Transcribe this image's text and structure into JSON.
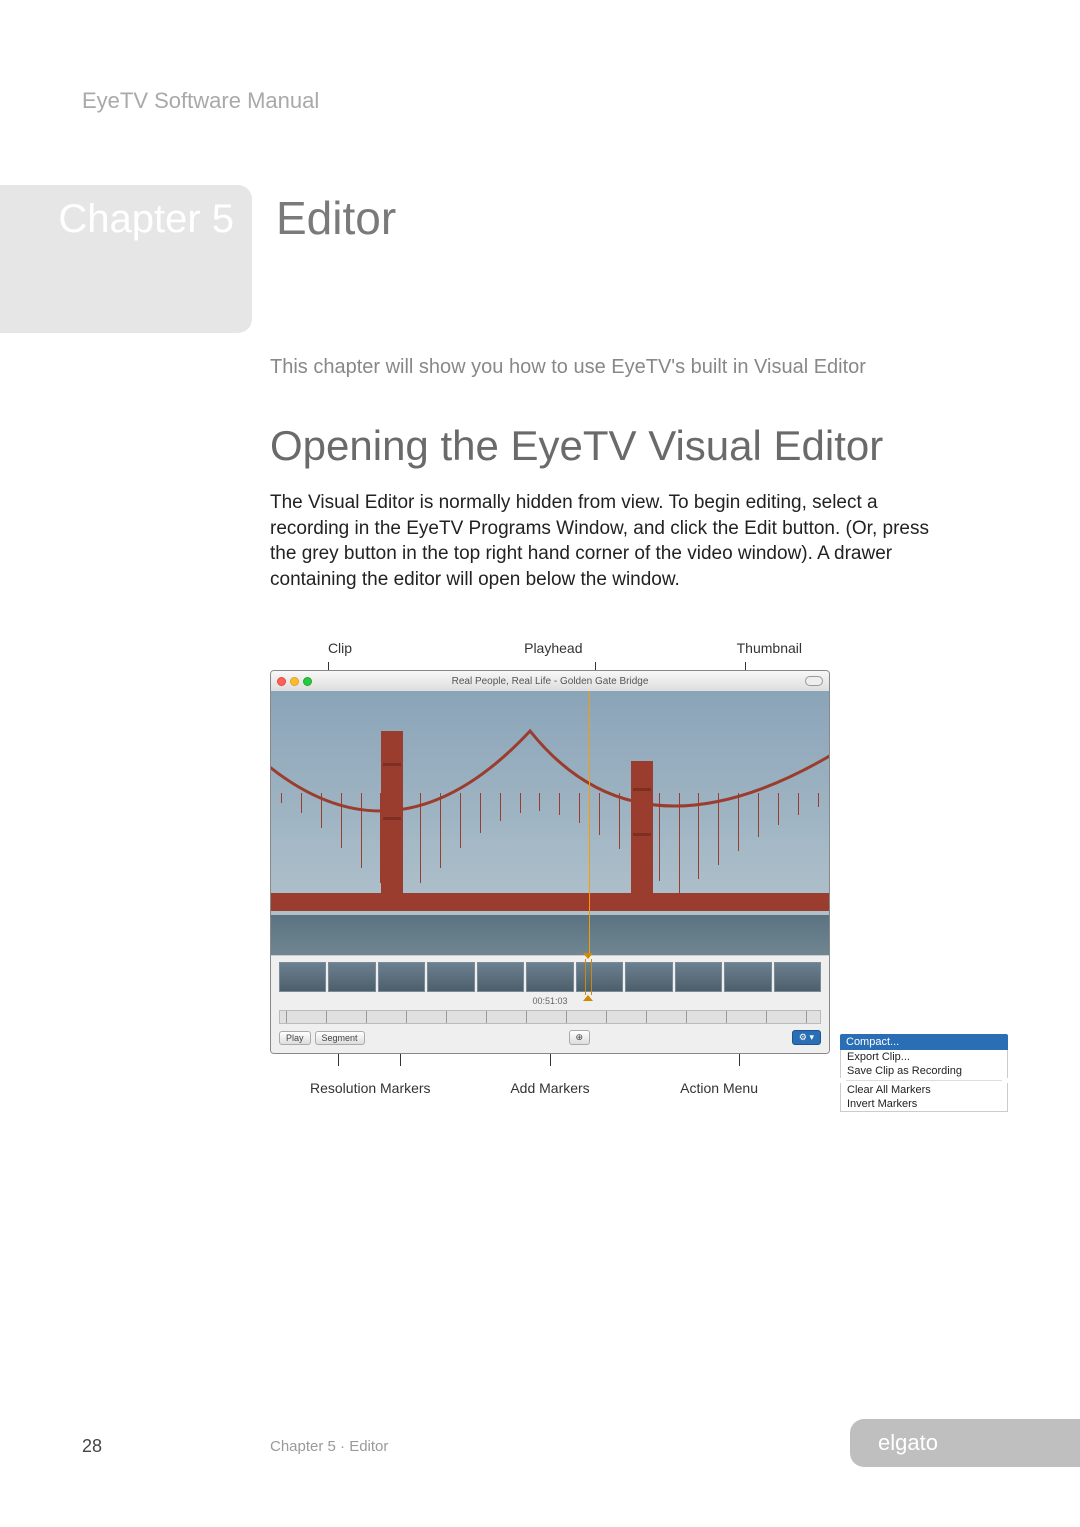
{
  "header": "EyeTV Software Manual",
  "chapter_label": "Chapter 5",
  "chapter_title": "Editor",
  "intro": "This chapter will show you how to use EyeTV's built in Visual Editor",
  "section_heading": "Opening the EyeTV Visual Editor",
  "body": "The Visual Editor is normally hidden from view. To begin editing, select a recording in the EyeTV Programs Window, and click the Edit button. (Or, press the grey button in the top right hand corner of the video window). A drawer containing the editor will open below the window.",
  "figure": {
    "callouts_top": {
      "clip": "Clip",
      "playhead": "Playhead",
      "thumbnail": "Thumbnail"
    },
    "window_title": "Real People, Real Life - Golden Gate Bridge",
    "toolbar": {
      "play": "Play",
      "segment": "Segment",
      "gear": "⚙︎ ▾"
    },
    "timecode": "00:51:03",
    "action_menu": {
      "compact": "Compact...",
      "export_clip": "Export Clip...",
      "save_clip": "Save Clip as Recording",
      "clear_all": "Clear All Markers",
      "invert": "Invert Markers"
    },
    "callouts_bottom": {
      "resolution": "Resolution",
      "markers": "Markers",
      "add_markers": "Add Markers",
      "action_menu": "Action Menu"
    }
  },
  "footer": {
    "page": "28",
    "chapter": "Chapter 5 · Editor",
    "brand": "elgato"
  }
}
